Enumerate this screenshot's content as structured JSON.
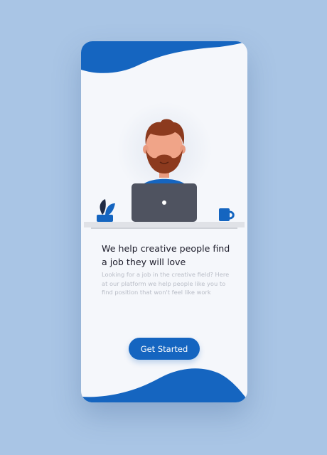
{
  "onboarding": {
    "headline": "We help creative people find a job they will love",
    "description": "Looking for a job in the creative field? Here at our platform we help people like you to find position that won't feel like work",
    "cta_label": "Get Started"
  },
  "illustration": {
    "subject": "man with beard working on laptop at desk",
    "items": [
      "plant-icon",
      "laptop-icon",
      "coffee-mug-icon"
    ]
  },
  "colors": {
    "accent": "#1565c0",
    "background": "#a9c5e5",
    "card": "#f5f7fb",
    "headline": "#1c1c2a",
    "body": "#b8bcc6"
  }
}
